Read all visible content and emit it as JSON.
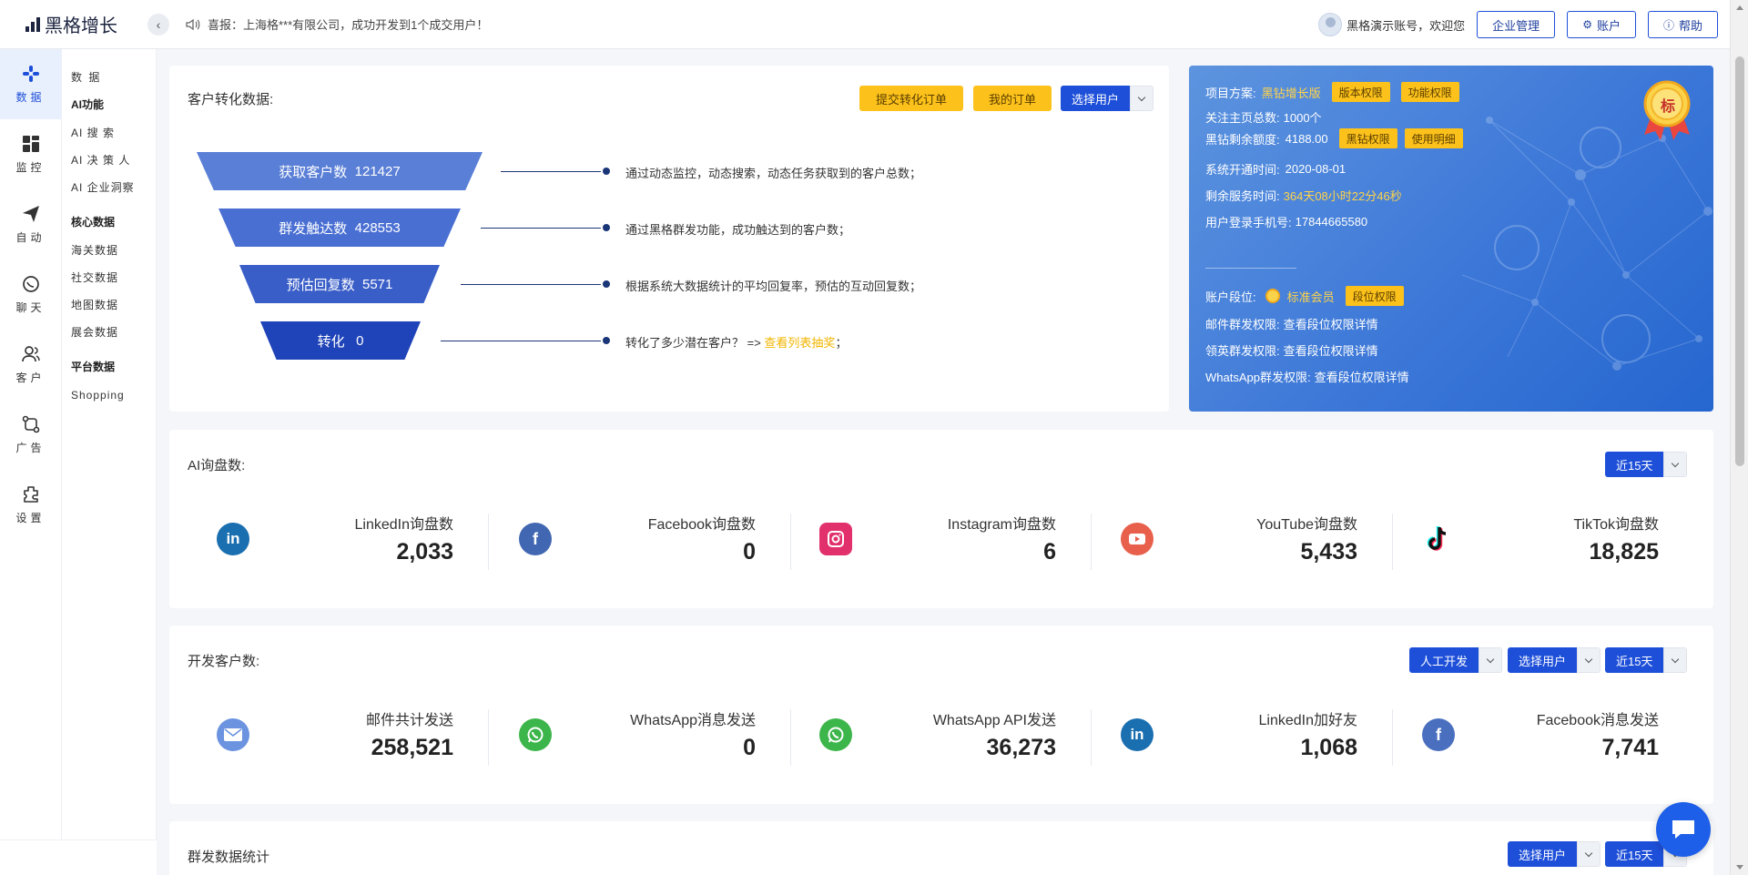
{
  "app": {
    "name": "黑格增长"
  },
  "notice": {
    "text": "喜报：上海格***有限公司，成功开发到1个成交用户！"
  },
  "header": {
    "greeting": "黑格演示账号，欢迎您",
    "buttons": {
      "enterprise": "企业管理",
      "account": "账户",
      "help": "帮助"
    }
  },
  "nav": {
    "items": [
      {
        "label": "数据",
        "icon": "data-icon"
      },
      {
        "label": "监控",
        "icon": "monitor-icon"
      },
      {
        "label": "自动",
        "icon": "send-icon"
      },
      {
        "label": "聊天",
        "icon": "chat-icon"
      },
      {
        "label": "客户",
        "icon": "customer-icon"
      },
      {
        "label": "广告",
        "icon": "ads-icon"
      },
      {
        "label": "设置",
        "icon": "settings-icon"
      }
    ]
  },
  "subnav": {
    "title": "数 据",
    "groups": [
      {
        "heading": "AI功能",
        "items": [
          "AI 搜 索",
          "AI 决 策 人",
          "AI 企业洞察"
        ]
      },
      {
        "heading": "核心数据",
        "items": [
          "海关数据",
          "社交数据",
          "地图数据",
          "展会数据"
        ]
      },
      {
        "heading": "平台数据",
        "items": [
          "Shopping"
        ]
      }
    ]
  },
  "conversion": {
    "title": "客户转化数据:",
    "buttons": {
      "submit": "提交转化订单",
      "orders": "我的订单",
      "select_user": "选择用户"
    },
    "funnel": [
      {
        "label": "获取客户数",
        "value": "121427",
        "desc": "通过动态监控，动态搜索，动态任务获取到的客户总数；"
      },
      {
        "label": "群发触达数",
        "value": "428553",
        "desc": "通过黑格群发功能，成功触达到的客户数；"
      },
      {
        "label": "预估回复数",
        "value": "5571",
        "desc": "根据系统大数据统计的平均回复率，预估的互动回复数；"
      },
      {
        "label": "转化",
        "value": "0",
        "desc": "转化了多少潜在客户？ =>",
        "link": "查看列表抽奖",
        "tail": "；"
      }
    ],
    "colors": [
      "#5a7fd6",
      "#4a6fd3",
      "#3a5ec8",
      "#1f43b8"
    ]
  },
  "plan": {
    "badge": "标",
    "project_label": "项目方案:",
    "project_value": "黑钻增长版",
    "tag_version": "版本权限",
    "tag_feature": "功能权限",
    "follow_label": "关注主页总数:",
    "follow_value": "1000个",
    "quota_label": "黑钻剩余额度:",
    "quota_value": "4188.00",
    "tag_diamond": "黑钻权限",
    "tag_usage": "使用明细",
    "open_label": "系统开通时间:",
    "open_value": "2020-08-01",
    "remain_label": "剩余服务时间:",
    "remain_value": "364天08小时22分46秒",
    "phone_label": "用户登录手机号:",
    "phone_value": "17844665580",
    "rank_label": "账户段位:",
    "rank_value": "标准会员",
    "tag_rank": "段位权限",
    "email_perm_label": "邮件群发权限:",
    "email_perm_value": "查看段位权限详情",
    "linkedin_perm_label": "领英群发权限:",
    "linkedin_perm_value": "查看段位权限详情",
    "whatsapp_perm_label": "WhatsApp群发权限:",
    "whatsapp_perm_value": "查看段位权限详情"
  },
  "ai_inquiry": {
    "title": "AI询盘数:",
    "range": "近15天",
    "stats": [
      {
        "label": "LinkedIn询盘数",
        "value": "2,033",
        "icon": "linkedin-icon",
        "color": "#1a6fb0"
      },
      {
        "label": "Facebook询盘数",
        "value": "0",
        "icon": "facebook-icon",
        "color": "#4267b2"
      },
      {
        "label": "Instagram询盘数",
        "value": "6",
        "icon": "instagram-icon",
        "color": "#e1306c"
      },
      {
        "label": "YouTube询盘数",
        "value": "5,433",
        "icon": "youtube-icon",
        "color": "#e8604c"
      },
      {
        "label": "TikTok询盘数",
        "value": "18,825",
        "icon": "tiktok-icon",
        "color": "#111111"
      }
    ]
  },
  "dev_customers": {
    "title": "开发客户数:",
    "mode": "人工开发",
    "select_user": "选择用户",
    "range": "近15天",
    "stats": [
      {
        "label": "邮件共计发送",
        "value": "258,521",
        "icon": "mail-icon",
        "color": "#6b93e0"
      },
      {
        "label": "WhatsApp消息发送",
        "value": "0",
        "icon": "whatsapp-icon",
        "color": "#3cb54a"
      },
      {
        "label": "WhatsApp API发送",
        "value": "36,273",
        "icon": "whatsapp-icon",
        "color": "#3cb54a"
      },
      {
        "label": "LinkedIn加好友",
        "value": "1,068",
        "icon": "linkedin-icon",
        "color": "#1a6fb0"
      },
      {
        "label": "Facebook消息发送",
        "value": "7,741",
        "icon": "facebook-icon",
        "color": "#4a6fbf"
      }
    ]
  },
  "mass_stats": {
    "title": "群发数据统计",
    "select_user": "选择用户",
    "range": "近15天"
  }
}
